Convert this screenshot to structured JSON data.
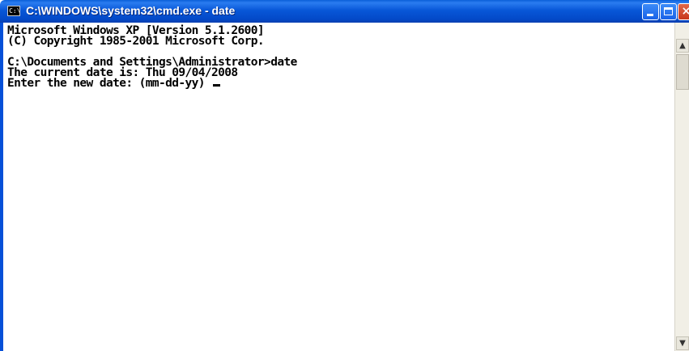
{
  "window": {
    "title": "C:\\WINDOWS\\system32\\cmd.exe - date",
    "icon": "cmd-icon",
    "icon_text": "C:\\",
    "buttons": {
      "minimize": "minimize-icon",
      "maximize": "maximize-icon",
      "close_label": "×"
    }
  },
  "console": {
    "lines": [
      "Microsoft Windows XP [Version 5.1.2600]",
      "(C) Copyright 1985-2001 Microsoft Corp.",
      "",
      "C:\\Documents and Settings\\Administrator>date",
      "The current date is: Thu 09/04/2008",
      "Enter the new date: (mm-dd-yy) "
    ]
  },
  "scrollbar": {
    "up_arrow": "▲",
    "down_arrow": "▼"
  },
  "colors": {
    "titlebar": "#0a5fd8",
    "console_bg": "#ffffff",
    "console_text": "#000000"
  }
}
